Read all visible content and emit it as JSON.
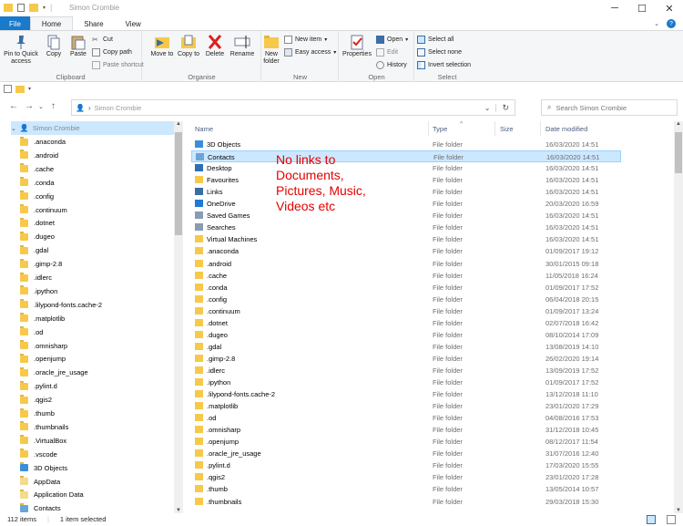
{
  "window": {
    "title": "Simon Crombie",
    "minimize_icon": "minimize-icon",
    "maximize_icon": "maximize-icon",
    "close_icon": "close-icon"
  },
  "tabs": [
    "File",
    "Home",
    "Share",
    "View"
  ],
  "ribbon": {
    "clipboard": {
      "label": "Clipboard",
      "pin": "Pin to Quick access",
      "copy": "Copy",
      "paste": "Paste",
      "cut": "Cut",
      "copy_path": "Copy path",
      "paste_shortcut": "Paste shortcut"
    },
    "organise": {
      "label": "Organise",
      "move_to": "Move to",
      "copy_to": "Copy to",
      "delete": "Delete",
      "rename": "Rename"
    },
    "new": {
      "label": "New",
      "new_folder": "New folder",
      "new_item": "New item",
      "easy_access": "Easy access"
    },
    "open": {
      "label": "Open",
      "properties": "Properties",
      "open": "Open",
      "edit": "Edit",
      "history": "History"
    },
    "select": {
      "label": "Select",
      "select_all": "Select all",
      "select_none": "Select none",
      "invert": "Invert selection"
    }
  },
  "address": {
    "path": "Simon Crombie",
    "search_placeholder": "Search Simon Crombie"
  },
  "nav_tree": {
    "root": "Simon Crombie",
    "items": [
      ".anaconda",
      ".android",
      ".cache",
      ".conda",
      ".config",
      ".continuum",
      ".dotnet",
      ".dugeo",
      ".gdal",
      ".gimp-2.8",
      ".idlerc",
      ".ipython",
      ".lilypond-fonts.cache-2",
      ".matplotlib",
      ".od",
      ".omnisharp",
      ".openjump",
      ".oracle_jre_usage",
      ".pylint.d",
      ".qgis2",
      ".thumb",
      ".thumbnails",
      ".VirtualBox",
      ".vscode",
      "3D Objects",
      "AppData",
      "Application Data",
      "Contacts"
    ]
  },
  "columns": {
    "name": "Name",
    "type": "Type",
    "size": "Size",
    "date": "Date modified"
  },
  "files": [
    {
      "name": "3D Objects",
      "type": "File folder",
      "date": "16/03/2020 14:51",
      "icon": "3d-objects-icon"
    },
    {
      "name": "Contacts",
      "type": "File folder",
      "date": "16/03/2020 14:51",
      "icon": "contacts-icon"
    },
    {
      "name": "Desktop",
      "type": "File folder",
      "date": "16/03/2020 14:51",
      "icon": "desktop-icon"
    },
    {
      "name": "Favourites",
      "type": "File folder",
      "date": "16/03/2020 14:51",
      "icon": "star-icon"
    },
    {
      "name": "Links",
      "type": "File folder",
      "date": "16/03/2020 14:51",
      "icon": "links-icon"
    },
    {
      "name": "OneDrive",
      "type": "File folder",
      "date": "20/03/2020 16:59",
      "icon": "cloud-icon"
    },
    {
      "name": "Saved Games",
      "type": "File folder",
      "date": "16/03/2020 14:51",
      "icon": "games-icon"
    },
    {
      "name": "Searches",
      "type": "File folder",
      "date": "16/03/2020 14:51",
      "icon": "search-icon"
    },
    {
      "name": "Virtual Machines",
      "type": "File folder",
      "date": "16/03/2020 14:51",
      "icon": "folder-icon"
    },
    {
      "name": ".anaconda",
      "type": "File folder",
      "date": "01/09/2017 19:12",
      "icon": "folder-icon"
    },
    {
      "name": ".android",
      "type": "File folder",
      "date": "30/01/2015 09:18",
      "icon": "folder-icon"
    },
    {
      "name": ".cache",
      "type": "File folder",
      "date": "11/05/2018 16:24",
      "icon": "folder-icon"
    },
    {
      "name": ".conda",
      "type": "File folder",
      "date": "01/09/2017 17:52",
      "icon": "folder-icon"
    },
    {
      "name": ".config",
      "type": "File folder",
      "date": "06/04/2018 20:15",
      "icon": "folder-icon"
    },
    {
      "name": ".continuum",
      "type": "File folder",
      "date": "01/09/2017 13:24",
      "icon": "folder-icon"
    },
    {
      "name": ".dotnet",
      "type": "File folder",
      "date": "02/07/2018 16:42",
      "icon": "folder-icon"
    },
    {
      "name": ".dugeo",
      "type": "File folder",
      "date": "08/10/2014 17:09",
      "icon": "folder-icon"
    },
    {
      "name": ".gdal",
      "type": "File folder",
      "date": "13/08/2019 14:10",
      "icon": "folder-icon"
    },
    {
      "name": ".gimp-2.8",
      "type": "File folder",
      "date": "26/02/2020 19:14",
      "icon": "folder-icon"
    },
    {
      "name": ".idlerc",
      "type": "File folder",
      "date": "13/09/2019 17:52",
      "icon": "folder-icon"
    },
    {
      "name": ".ipython",
      "type": "File folder",
      "date": "01/09/2017 17:52",
      "icon": "folder-icon"
    },
    {
      "name": ".lilypond-fonts.cache-2",
      "type": "File folder",
      "date": "13/12/2018 11:10",
      "icon": "folder-icon"
    },
    {
      "name": ".matplotlib",
      "type": "File folder",
      "date": "23/01/2020 17:29",
      "icon": "folder-icon"
    },
    {
      "name": ".od",
      "type": "File folder",
      "date": "04/08/2016 17:53",
      "icon": "folder-icon"
    },
    {
      "name": ".omnisharp",
      "type": "File folder",
      "date": "31/12/2018 10:45",
      "icon": "folder-icon"
    },
    {
      "name": ".openjump",
      "type": "File folder",
      "date": "08/12/2017 11:54",
      "icon": "folder-icon"
    },
    {
      "name": ".oracle_jre_usage",
      "type": "File folder",
      "date": "31/07/2016 12:40",
      "icon": "folder-icon"
    },
    {
      "name": ".pylint.d",
      "type": "File folder",
      "date": "17/03/2020 15:55",
      "icon": "folder-icon"
    },
    {
      "name": ".qgis2",
      "type": "File folder",
      "date": "23/01/2020 17:28",
      "icon": "folder-icon"
    },
    {
      "name": ".thumb",
      "type": "File folder",
      "date": "13/05/2014 10:57",
      "icon": "folder-icon"
    },
    {
      "name": ".thumbnails",
      "type": "File folder",
      "date": "29/03/2018 15:30",
      "icon": "folder-icon"
    }
  ],
  "annotation": [
    "No links to",
    "Documents,",
    "Pictures, Music,",
    "Videos etc"
  ],
  "status": {
    "count": "112 items",
    "selected": "1 item selected"
  },
  "colors": {
    "accent": "#1979ca",
    "selection": "#cce8ff",
    "annotation": "#e50000",
    "folder": "#f6c94a"
  }
}
